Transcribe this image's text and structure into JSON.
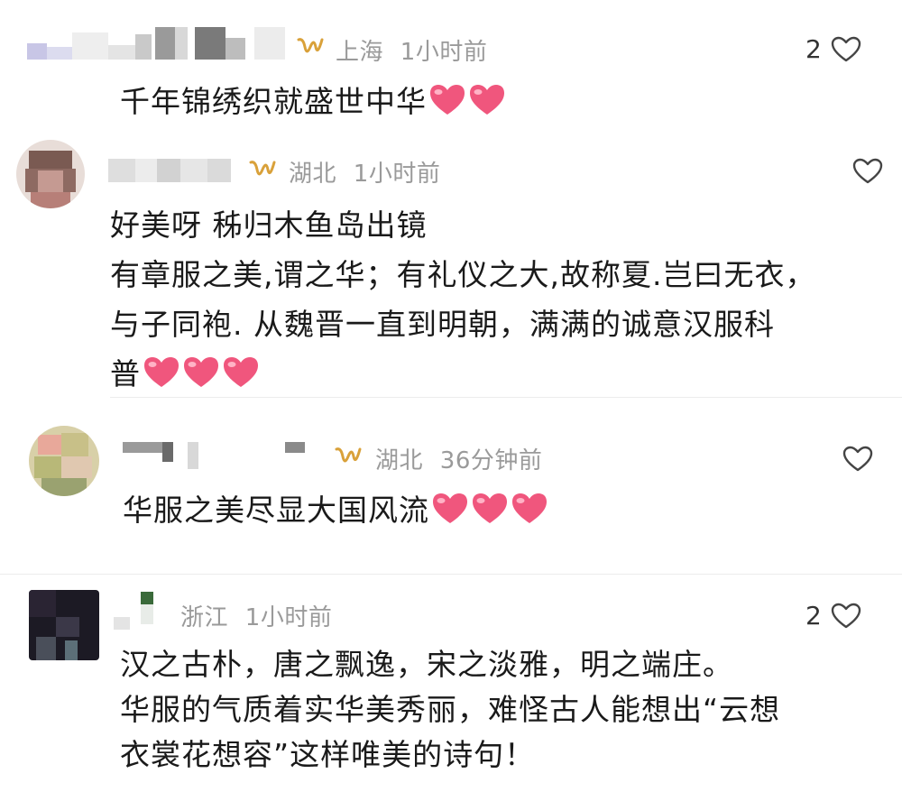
{
  "colors": {
    "meta": "#9a9a9a",
    "heart": "#f0567d",
    "gold": "#d9a13a",
    "divider": "#ececec"
  },
  "comments": [
    {
      "location": "上海",
      "time": "1小时前",
      "likes": "2",
      "lines": [
        "千年锦绣织就盛世中华"
      ],
      "heart_emojis": 2
    },
    {
      "location": "湖北",
      "time": "1小时前",
      "likes": "",
      "lines": [
        "好美呀  秭归木鱼岛出镜",
        "有章服之美,谓之华；有礼仪之大,故称夏.岂曰无衣，",
        "与子同袍. 从魏晋一直到明朝，满满的诚意汉服科",
        "普"
      ],
      "heart_emojis": 3
    },
    {
      "location": "湖北",
      "time": "36分钟前",
      "likes": "",
      "lines": [
        "华服之美尽显大国风流"
      ],
      "heart_emojis": 3
    },
    {
      "location": "浙江",
      "time": "1小时前",
      "likes": "2",
      "lines": [
        "汉之古朴，唐之飘逸，宋之淡雅，明之端庄。",
        "华服的气质着实华美秀丽，难怪古人能想出“云想",
        "衣裳花想容”这样唯美的诗句！"
      ],
      "heart_emojis": 0
    }
  ]
}
